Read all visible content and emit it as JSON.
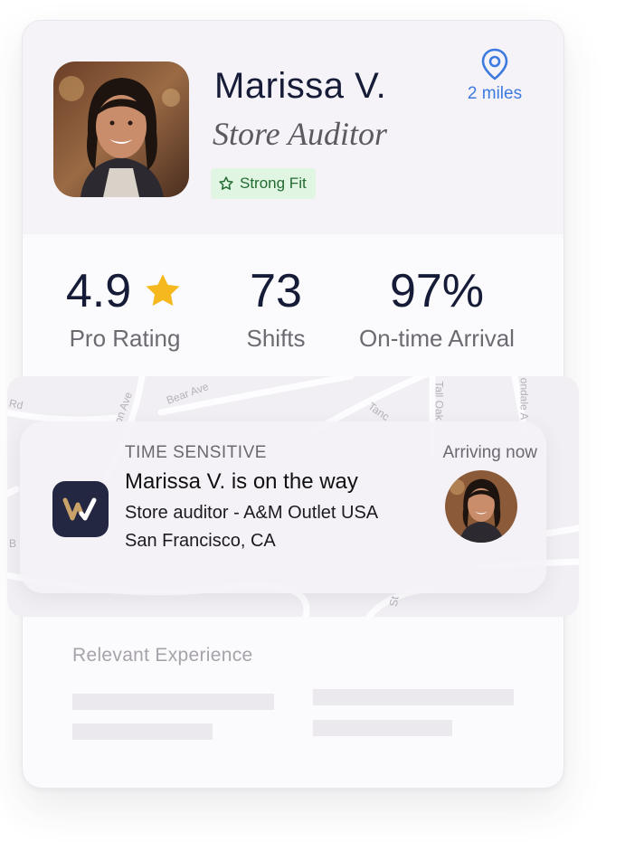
{
  "profile": {
    "name": "Marissa V.",
    "role": "Store Auditor",
    "badge": "Strong Fit",
    "distance": "2 miles"
  },
  "stats": [
    {
      "value": "4.9",
      "label": "Pro Rating"
    },
    {
      "value": "73",
      "label": "Shifts"
    },
    {
      "value": "97%",
      "label": "On-time Arrival"
    }
  ],
  "map": {
    "streets": [
      "Bear Ave",
      "Tall Oak",
      "ondale A",
      "Rd",
      "on Ave",
      "Tanc",
      "St",
      "B"
    ]
  },
  "notification": {
    "eyebrow": "TIME SENSITIVE",
    "time": "Arriving now",
    "title": "Marissa V. is on the way",
    "line1": "Store auditor -  A&M Outlet USA",
    "line2": "San Francisco, CA"
  },
  "experience": {
    "title": "Relevant Experience"
  },
  "colors": {
    "accent_blue": "#3d7ae0",
    "star": "#f5b81e",
    "badge_bg": "#e1f5e3",
    "badge_text": "#226b31",
    "app_icon_bg": "#232741"
  },
  "icons": {
    "location": "location-pin-icon",
    "badge": "star-outline-icon",
    "rating": "star-icon",
    "app": "w-logo-icon"
  }
}
